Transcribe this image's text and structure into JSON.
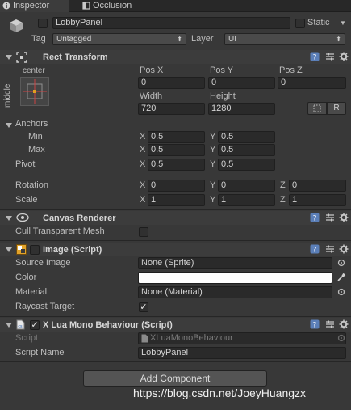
{
  "tabs": [
    {
      "label": "Inspector",
      "icon": "info-icon",
      "active": true
    },
    {
      "label": "Occlusion",
      "icon": "occlusion-icon",
      "active": false
    }
  ],
  "object": {
    "name": "LobbyPanel",
    "static_label": "Static",
    "tag_label": "Tag",
    "tag_value": "Untagged",
    "layer_label": "Layer",
    "layer_value": "UI"
  },
  "rect_transform": {
    "title": "Rect Transform",
    "anchor_preset_top": "center",
    "anchor_preset_side": "middle",
    "headers": {
      "posx": "Pos X",
      "posy": "Pos Y",
      "posz": "Pos Z",
      "width": "Width",
      "height": "Height"
    },
    "values": {
      "posx": "0",
      "posy": "0",
      "posz": "0",
      "width": "720",
      "height": "1280"
    },
    "r_button": "R",
    "anchors_label": "Anchors",
    "min_label": "Min",
    "max_label": "Max",
    "min": {
      "x": "0.5",
      "y": "0.5"
    },
    "max": {
      "x": "0.5",
      "y": "0.5"
    },
    "pivot_label": "Pivot",
    "pivot": {
      "x": "0.5",
      "y": "0.5"
    },
    "rotation_label": "Rotation",
    "rotation": {
      "x": "0",
      "y": "0",
      "z": "0"
    },
    "scale_label": "Scale",
    "scale": {
      "x": "1",
      "y": "1",
      "z": "1"
    },
    "axis": {
      "x": "X",
      "y": "Y",
      "z": "Z"
    }
  },
  "canvas_renderer": {
    "title": "Canvas Renderer",
    "cull_label": "Cull Transparent Mesh",
    "cull_checked": false
  },
  "image": {
    "title": "Image (Script)",
    "source_label": "Source Image",
    "source_value": "None (Sprite)",
    "color_label": "Color",
    "color_value": "#ffffff",
    "material_label": "Material",
    "material_value": "None (Material)",
    "raycast_label": "Raycast Target",
    "raycast_checked": true
  },
  "xlua": {
    "title": "X Lua Mono Behaviour (Script)",
    "script_label": "Script",
    "script_value": "XLuaMonoBehaviour",
    "script_name_label": "Script Name",
    "script_name_value": "LobbyPanel"
  },
  "add_component": "Add Component",
  "watermark": "https://blog.csdn.net/JoeyHuangzx",
  "colors": {
    "panel": "#383838",
    "field": "#2a2a2a",
    "accent_link": "#4a8fd6"
  }
}
